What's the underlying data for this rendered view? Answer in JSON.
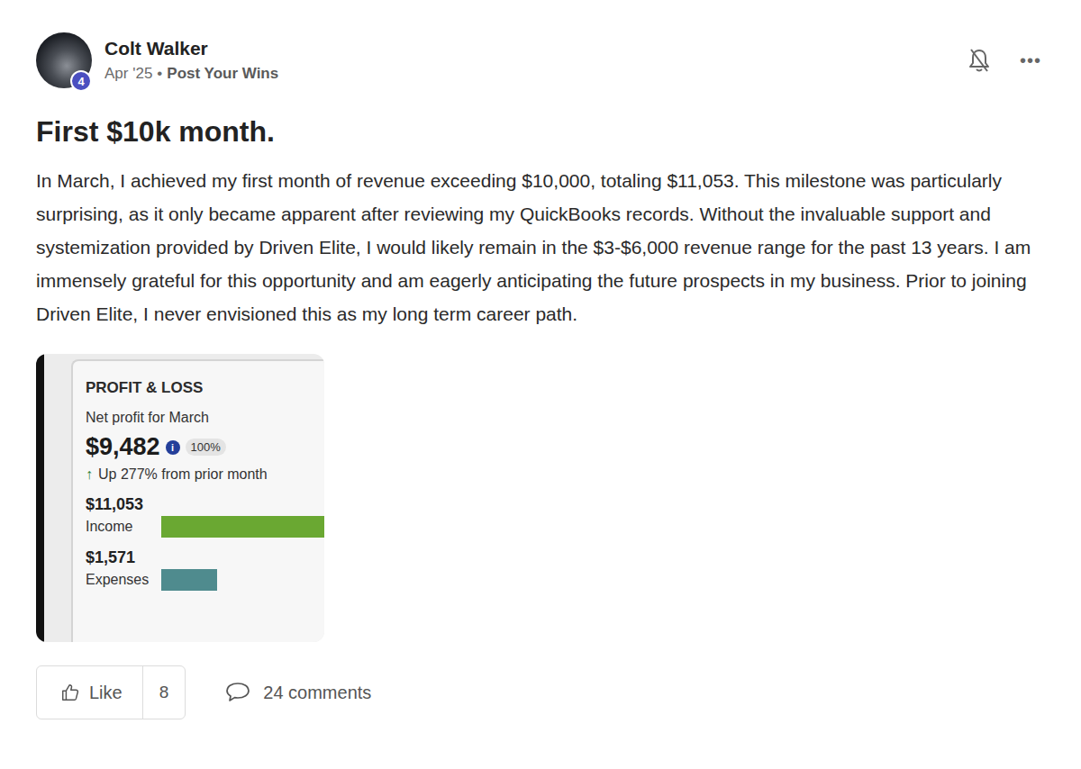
{
  "author": {
    "name": "Colt Walker",
    "level": "4",
    "date": "Apr '25",
    "separator": "•",
    "category": "Post Your Wins"
  },
  "header_icons": {
    "notifications_on": false,
    "menu": "•••"
  },
  "title": "First $10k month.",
  "body": "In March, I achieved my first month of revenue exceeding $10,000, totaling $11,053. This milestone was particularly surprising, as it only became apparent after reviewing my QuickBooks records. Without the invaluable support and systemization provided by Driven Elite, I would likely remain in the $3-$6,000 revenue range for the past 13 years. I am immensely grateful for this opportunity and am eagerly anticipating the future prospects in my business. Prior to joining Driven Elite, I never envisioned this as my long term career path.",
  "attachment": {
    "heading": "PROFIT & LOSS",
    "subheading": "Net profit for March",
    "amount": "$9,482",
    "info_icon": "i",
    "badge": "100%",
    "change_icon": "↑",
    "change": "Up 277% from prior month",
    "bars": [
      {
        "amount": "$11,053",
        "label": "Income",
        "level": 1,
        "color": "#6aa832"
      },
      {
        "amount": "$1,571",
        "label": "Expenses",
        "level": 0.34,
        "color": "#4f8b8e"
      }
    ]
  },
  "actions": {
    "like_label": "Like",
    "like_count": "8",
    "comments": "24 comments"
  }
}
